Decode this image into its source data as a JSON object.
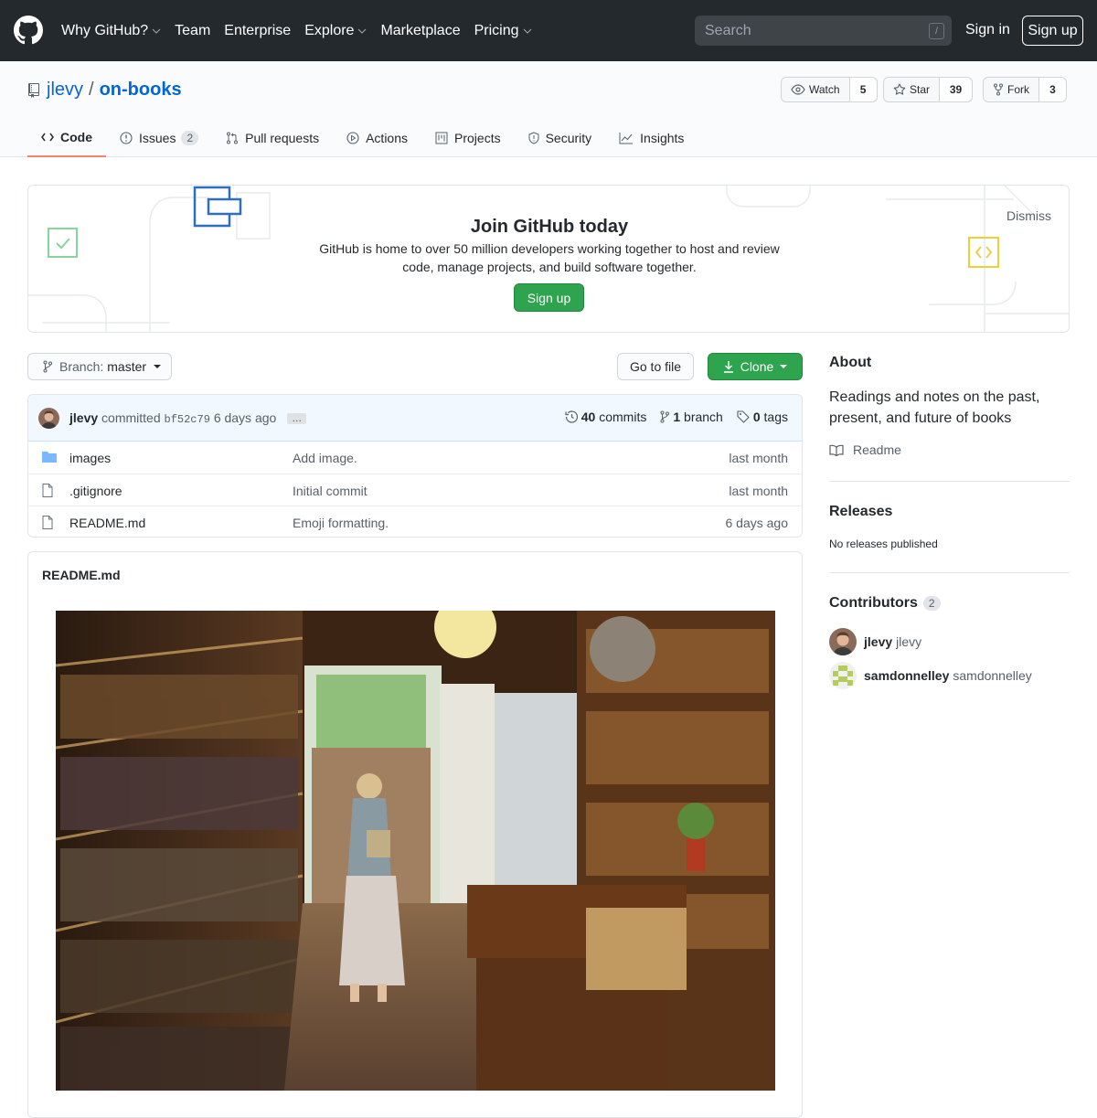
{
  "header": {
    "nav": [
      {
        "label": "Why GitHub?",
        "dropdown": true
      },
      {
        "label": "Team",
        "dropdown": false
      },
      {
        "label": "Enterprise",
        "dropdown": false
      },
      {
        "label": "Explore",
        "dropdown": true
      },
      {
        "label": "Marketplace",
        "dropdown": false
      },
      {
        "label": "Pricing",
        "dropdown": true
      }
    ],
    "search_placeholder": "Search",
    "search_shortcut": "/",
    "signin": "Sign in",
    "signup": "Sign up"
  },
  "repo": {
    "owner": "jlevy",
    "separator": "/",
    "name": "on-books",
    "watch_label": "Watch",
    "watch_count": "5",
    "star_label": "Star",
    "star_count": "39",
    "fork_label": "Fork",
    "fork_count": "3"
  },
  "tabs": [
    {
      "label": "Code",
      "selected": true,
      "icon": "code-icon"
    },
    {
      "label": "Issues",
      "count": "2",
      "icon": "issue-icon"
    },
    {
      "label": "Pull requests",
      "icon": "pull-request-icon"
    },
    {
      "label": "Actions",
      "icon": "play-icon"
    },
    {
      "label": "Projects",
      "icon": "project-icon"
    },
    {
      "label": "Security",
      "icon": "shield-icon"
    },
    {
      "label": "Insights",
      "icon": "graph-icon"
    }
  ],
  "banner": {
    "title": "Join GitHub today",
    "text": "GitHub is home to over 50 million developers working together to host and review code, manage projects, and build software together.",
    "button": "Sign up",
    "dismiss": "Dismiss"
  },
  "toolbar": {
    "branch_prefix": "Branch:",
    "branch_name": "master",
    "goto_file": "Go to file",
    "clone": "Clone"
  },
  "commit": {
    "author": "jlevy",
    "verb": "committed",
    "sha": "bf52c79",
    "age": "6 days ago",
    "ellipsis": "…",
    "commits_count": "40",
    "commits_label": "commits",
    "branch_count": "1",
    "branch_label": "branch",
    "tags_count": "0",
    "tags_label": "tags"
  },
  "files": [
    {
      "name": "images",
      "type": "folder",
      "message": "Add image.",
      "age": "last month"
    },
    {
      "name": ".gitignore",
      "type": "file",
      "message": "Initial commit",
      "age": "last month"
    },
    {
      "name": "README.md",
      "type": "file",
      "message": "Emoji formatting.",
      "age": "6 days ago"
    }
  ],
  "readme": {
    "title": "README.md"
  },
  "about": {
    "title": "About",
    "description": "Readings and notes on the past, present, and future of books",
    "readme_link": "Readme"
  },
  "releases": {
    "title": "Releases",
    "text": "No releases published"
  },
  "contributors": {
    "title": "Contributors",
    "count": "2",
    "list": [
      {
        "name": "jlevy",
        "login": "jlevy"
      },
      {
        "name": "samdonnelley",
        "login": "samdonnelley"
      }
    ]
  },
  "colors": {
    "header_bg": "#24292e",
    "link": "#0366d6",
    "green": "#2ea44f",
    "tab_underline": "#f9826c"
  }
}
